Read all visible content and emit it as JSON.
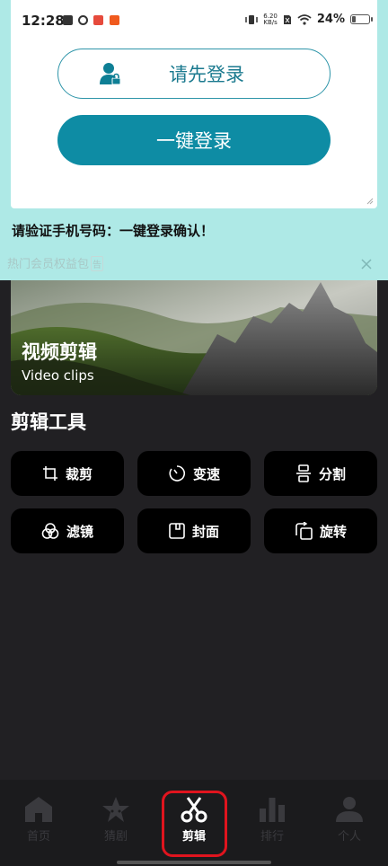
{
  "status_bar": {
    "time": "12:28",
    "net_speed_value": "6.20",
    "net_speed_unit": "KB/s",
    "battery_text": "24%",
    "battery_level": 0.24
  },
  "login": {
    "secondary_label": "请先登录",
    "primary_label": "一键登录",
    "verify_text": "请验证手机号码：一键登录确认！"
  },
  "promo": {
    "text": "热门会员权益包",
    "ad_badge": "告"
  },
  "banner": {
    "title": "视频剪辑",
    "subtitle": "Video clips"
  },
  "tools": {
    "section_title": "剪辑工具",
    "items": [
      {
        "label": "裁剪",
        "icon": "crop-icon"
      },
      {
        "label": "变速",
        "icon": "speed-icon"
      },
      {
        "label": "分割",
        "icon": "split-icon"
      },
      {
        "label": "滤镜",
        "icon": "filter-icon"
      },
      {
        "label": "封面",
        "icon": "cover-icon"
      },
      {
        "label": "旋转",
        "icon": "rotate-icon"
      }
    ]
  },
  "nav": {
    "items": [
      {
        "label": "首页",
        "icon": "home-icon"
      },
      {
        "label": "猜剧",
        "icon": "star-icon"
      },
      {
        "label": "剪辑",
        "icon": "scissors-icon"
      },
      {
        "label": "排行",
        "icon": "bar-chart-icon"
      },
      {
        "label": "个人",
        "icon": "person-icon"
      }
    ],
    "active_index": 2
  },
  "colors": {
    "accent": "#0e8ca4",
    "top_background": "#aee9e6",
    "page_background": "#212023",
    "highlight_ring": "#e0141e"
  }
}
